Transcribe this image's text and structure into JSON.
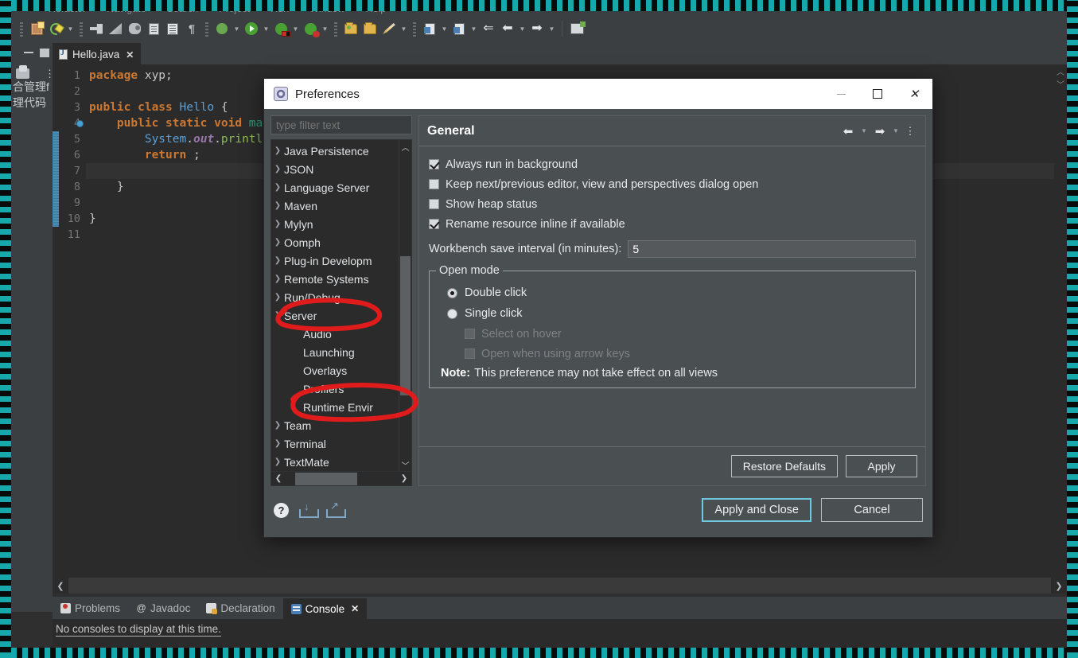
{
  "menubar": {
    "items": [
      "",
      "Refactor",
      "Navigate",
      "Search",
      "Project",
      "Run",
      "Window",
      "Help"
    ]
  },
  "toolbar": {
    "buttons": [
      "new-project-icon",
      "new-java-class-icon",
      "dropdown-1",
      "quick-access-icon",
      "ruler-icon",
      "debug-bug-icon",
      "doc-icon",
      "list-icon",
      "pilcrow-icon",
      "skip-breakpoints-icon",
      "dropdown-2",
      "run-icon",
      "dropdown-3",
      "run-server-icon",
      "dropdown-4",
      "debug-server-icon",
      "dropdown-5",
      "open-resource-icon",
      "open-folder-icon",
      "pen-icon",
      "dropdown-6",
      "search-icon",
      "dropdown-7",
      "search-ref-icon",
      "dropdown-8",
      "back-history-icon",
      "back-icon",
      "dropdown-9",
      "forward-icon",
      "dropdown-10",
      "open-perspective-icon"
    ]
  },
  "left_view": {
    "line1": "合管理f",
    "line2": "理代码",
    "minimize_icon": "minimize-icon",
    "maximize_icon": "maximize-icon",
    "view_menu_icon": "view-menu-icon",
    "package_icon": "package-presentation-icon"
  },
  "editor": {
    "tab_label": "Hello.java",
    "tab_close": "✕",
    "line_numbers": [
      "1",
      "2",
      "3",
      "4",
      "5",
      "6",
      "7",
      "8",
      "9",
      "10",
      "11"
    ],
    "breakpoint_line": 4,
    "current_line": 7,
    "code_lines": [
      {
        "n": 1,
        "tokens": [
          {
            "t": "kw",
            "v": "package"
          },
          {
            "t": "plain",
            "v": " xyp;"
          }
        ]
      },
      {
        "n": 2,
        "tokens": []
      },
      {
        "n": 3,
        "tokens": [
          {
            "t": "kw",
            "v": "public class "
          },
          {
            "t": "typ",
            "v": "Hello"
          },
          {
            "t": "plain",
            "v": " {"
          }
        ]
      },
      {
        "n": 4,
        "tokens": [
          {
            "t": "plain",
            "v": "    "
          },
          {
            "t": "kw",
            "v": "public static void "
          },
          {
            "t": "prm",
            "v": "ma"
          }
        ]
      },
      {
        "n": 5,
        "tokens": [
          {
            "t": "plain",
            "v": "        "
          },
          {
            "t": "typ",
            "v": "System"
          },
          {
            "t": "plain",
            "v": "."
          },
          {
            "t": "fld",
            "v": "out"
          },
          {
            "t": "plain",
            "v": "."
          },
          {
            "t": "mth",
            "v": "printl"
          }
        ]
      },
      {
        "n": 6,
        "tokens": [
          {
            "t": "plain",
            "v": "        "
          },
          {
            "t": "kw",
            "v": "return "
          },
          {
            "t": "plain",
            "v": ";"
          }
        ]
      },
      {
        "n": 7,
        "tokens": []
      },
      {
        "n": 8,
        "tokens": [
          {
            "t": "plain",
            "v": "    }"
          }
        ]
      },
      {
        "n": 9,
        "tokens": []
      },
      {
        "n": 10,
        "tokens": [
          {
            "t": "plain",
            "v": "}"
          }
        ]
      },
      {
        "n": 11,
        "tokens": []
      }
    ]
  },
  "bottom_views": {
    "tabs": [
      {
        "label": "Problems",
        "icon": "problems-icon",
        "active": false,
        "closable": false
      },
      {
        "label": "Javadoc",
        "icon": "javadoc-icon",
        "active": false,
        "closable": false
      },
      {
        "label": "Declaration",
        "icon": "declaration-icon",
        "active": false,
        "closable": false
      },
      {
        "label": "Console",
        "icon": "console-icon",
        "active": true,
        "closable": true
      }
    ],
    "console_message": "No consoles to display at this time."
  },
  "dialog": {
    "title": "Preferences",
    "title_icon": "preferences-icon",
    "window_buttons": {
      "minimize": "minimize-icon",
      "maximize": "maximize-icon",
      "close": "close-icon"
    },
    "filter_placeholder": "type filter text",
    "filter_value": "",
    "tree": [
      {
        "label": "Java Persistence",
        "expandable": true,
        "child": false
      },
      {
        "label": "JSON",
        "expandable": true,
        "child": false
      },
      {
        "label": "Language Server",
        "expandable": true,
        "child": false
      },
      {
        "label": "Maven",
        "expandable": true,
        "child": false
      },
      {
        "label": "Mylyn",
        "expandable": true,
        "child": false
      },
      {
        "label": "Oomph",
        "expandable": true,
        "child": false
      },
      {
        "label": "Plug-in Developm",
        "expandable": true,
        "child": false
      },
      {
        "label": "Remote Systems",
        "expandable": true,
        "child": false
      },
      {
        "label": "Run/Debug",
        "expandable": true,
        "child": false
      },
      {
        "label": "Server",
        "expandable": true,
        "child": false
      },
      {
        "label": "Audio",
        "expandable": false,
        "child": true
      },
      {
        "label": "Launching",
        "expandable": false,
        "child": true
      },
      {
        "label": "Overlays",
        "expandable": false,
        "child": true
      },
      {
        "label": "Profilers",
        "expandable": false,
        "child": true
      },
      {
        "label": "Runtime Envir",
        "expandable": false,
        "child": true
      },
      {
        "label": "Team",
        "expandable": true,
        "child": false
      },
      {
        "label": "Terminal",
        "expandable": true,
        "child": false
      },
      {
        "label": "TextMate",
        "expandable": true,
        "child": false
      }
    ],
    "page": {
      "title": "General",
      "nav": {
        "back_icon": "back-arrow-icon",
        "back_dropdown_icon": "chevron-down-icon",
        "forward_icon": "forward-arrow-icon",
        "forward_dropdown_icon": "chevron-down-icon",
        "menu_icon": "vertical-dots-icon"
      },
      "checkboxes": [
        {
          "label": "Always run in background",
          "checked": true,
          "disabled": false,
          "mnemonic": "u"
        },
        {
          "label": "Keep next/previous editor, view and perspectives dialog open",
          "checked": false,
          "disabled": false,
          "mnemonic": "n"
        },
        {
          "label": "Show heap status",
          "checked": false,
          "disabled": false,
          "mnemonic": "w"
        },
        {
          "label": "Rename resource inline if available",
          "checked": true,
          "disabled": false,
          "mnemonic": "R"
        }
      ],
      "save_interval": {
        "label": "Workbench save interval (in minutes):",
        "value": "5"
      },
      "open_mode": {
        "legend": "Open mode",
        "options": [
          {
            "label": "Double click",
            "selected": true
          },
          {
            "label": "Single click",
            "selected": false
          }
        ],
        "sub_checkboxes": [
          {
            "label": "Select on hover",
            "checked": false,
            "disabled": true
          },
          {
            "label": "Open when using arrow keys",
            "checked": false,
            "disabled": true
          }
        ],
        "note_prefix": "Note:",
        "note_text": "This preference may not take effect on all views"
      },
      "buttons": {
        "restore_defaults": "Restore Defaults",
        "apply": "Apply"
      }
    },
    "footer": {
      "help_icon": "help-icon",
      "import_icon": "import-icon",
      "export_icon": "export-icon",
      "apply_and_close": "Apply and Close",
      "cancel": "Cancel"
    }
  },
  "annotations": {
    "color": "#e01b1b",
    "marks": [
      "circle-around-server",
      "circle-around-runtime-environments"
    ]
  }
}
